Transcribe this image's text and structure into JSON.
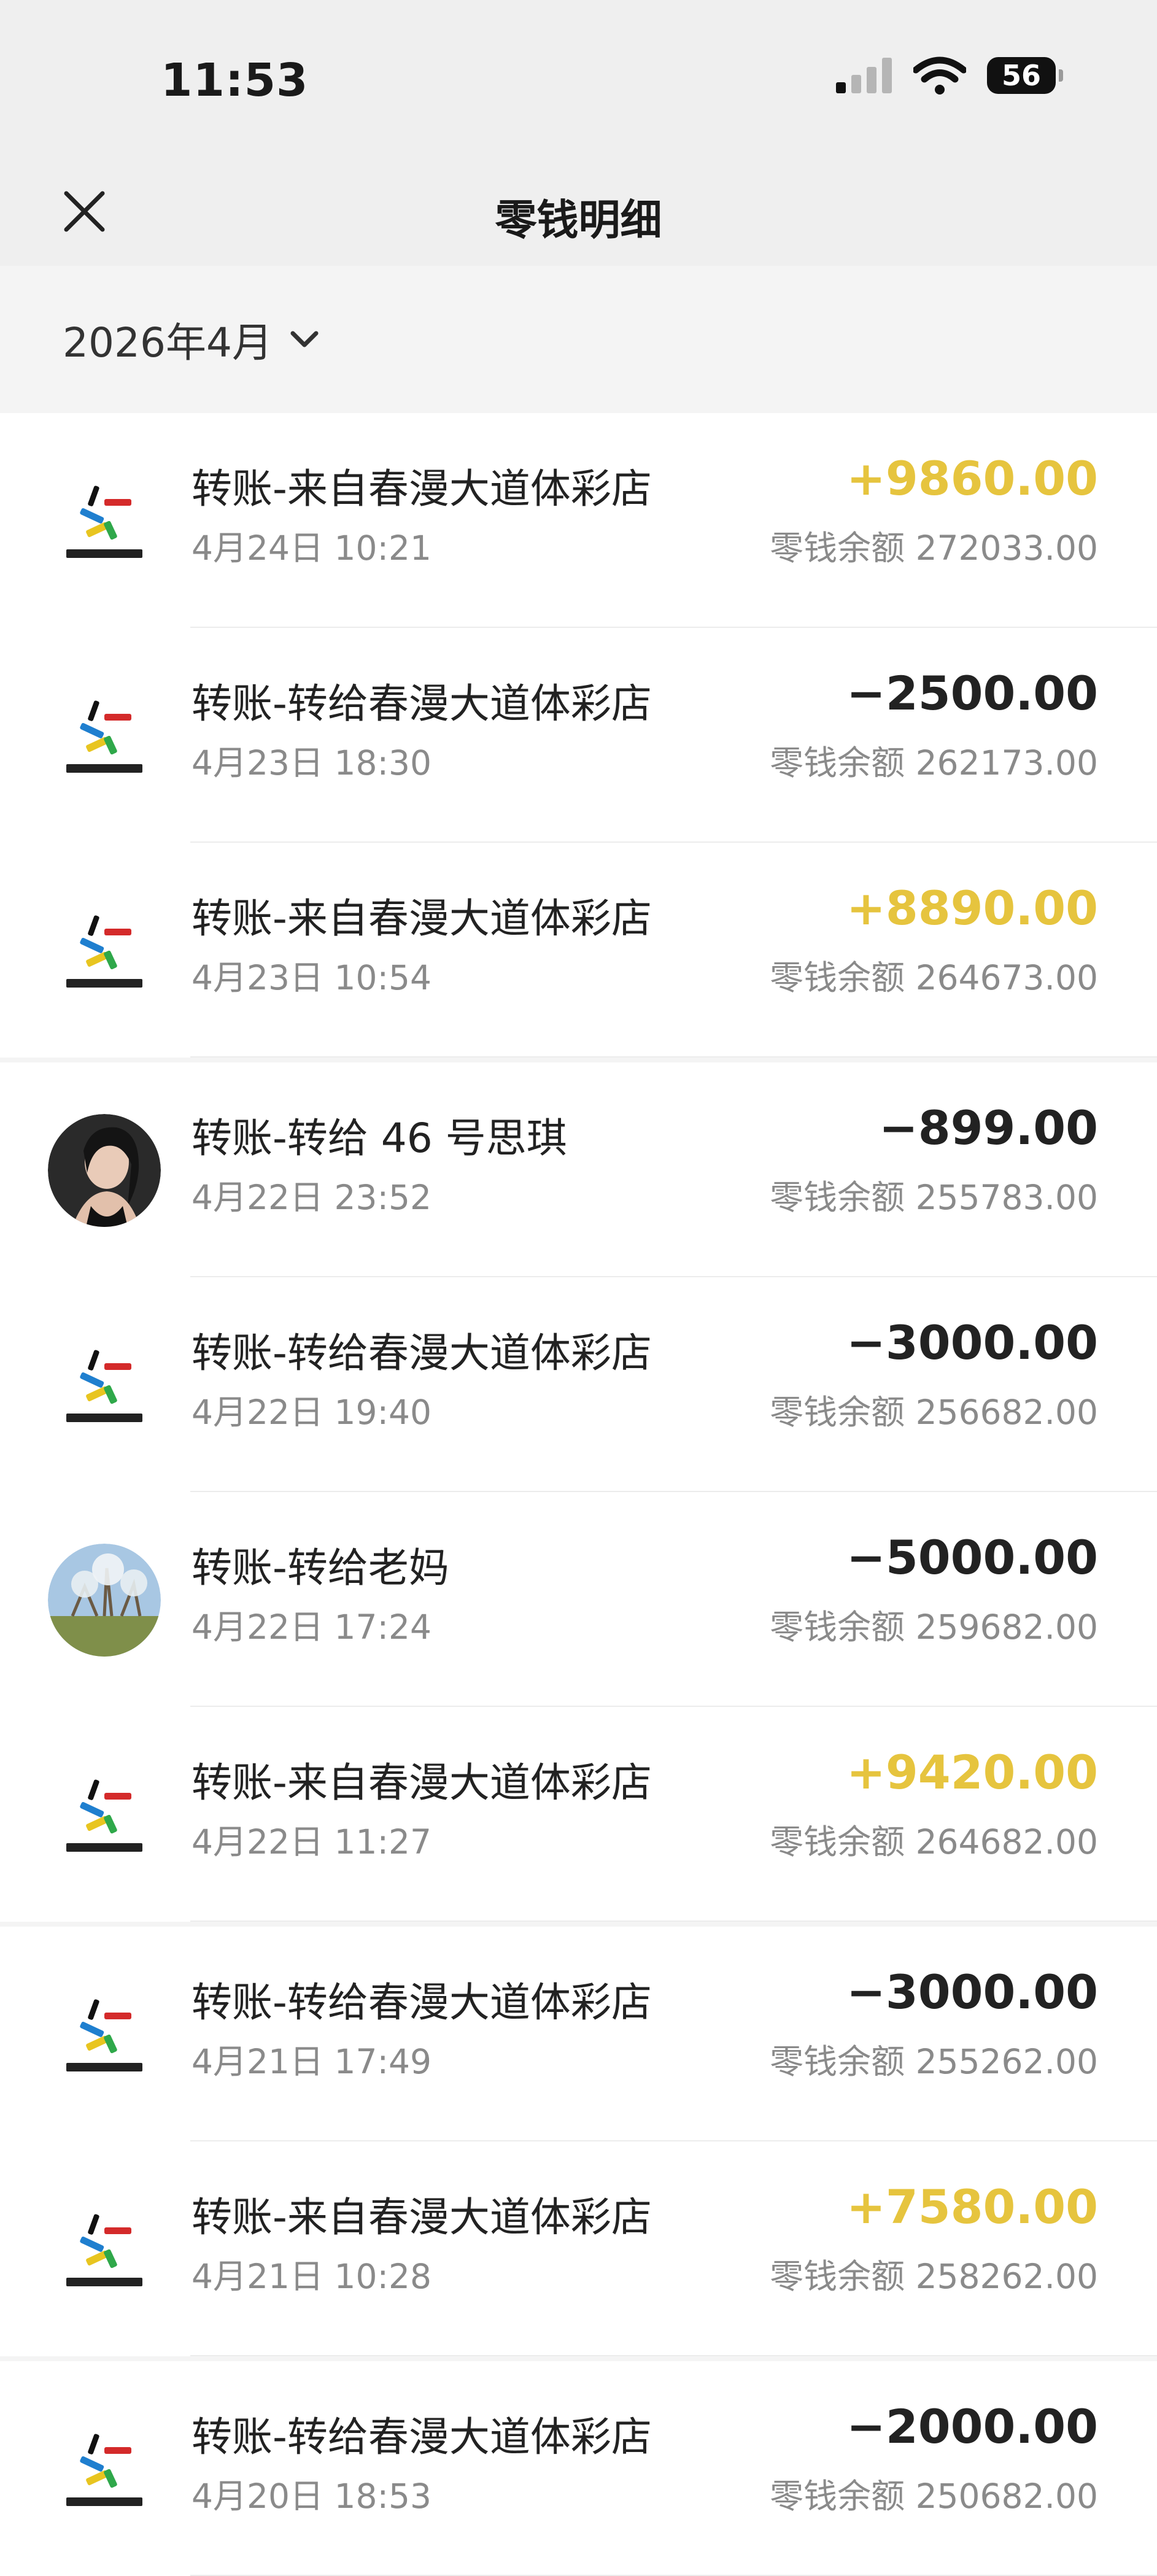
{
  "status": {
    "time": "11:53",
    "battery": "56"
  },
  "header": {
    "title": "零钱明细"
  },
  "filter": {
    "month": "2026年4月"
  },
  "balance_prefix": "零钱余额",
  "colors": {
    "income": "#e6c43e",
    "expense": "#222222",
    "background": "#f4f4f4"
  },
  "transactions": [
    {
      "title": "转账-来自春漫大道体彩店",
      "time": "4月24日 10:21",
      "amount": "+9860.00",
      "balance": "272033.00",
      "avatar": "lottery-logo"
    },
    {
      "title": "转账-转给春漫大道体彩店",
      "time": "4月23日 18:30",
      "amount": "−2500.00",
      "balance": "262173.00",
      "avatar": "lottery-logo"
    },
    {
      "title": "转账-来自春漫大道体彩店",
      "time": "4月23日 10:54",
      "amount": "+8890.00",
      "balance": "264673.00",
      "avatar": "lottery-logo"
    },
    {
      "title": "转账-转给 46 号思琪",
      "time": "4月22日 23:52",
      "amount": "−899.00",
      "balance": "255783.00",
      "avatar": "person-photo"
    },
    {
      "title": "转账-转给春漫大道体彩店",
      "time": "4月22日 19:40",
      "amount": "−3000.00",
      "balance": "256682.00",
      "avatar": "lottery-logo"
    },
    {
      "title": "转账-转给老妈",
      "time": "4月22日 17:24",
      "amount": "−5000.00",
      "balance": "259682.00",
      "avatar": "landscape-photo"
    },
    {
      "title": "转账-来自春漫大道体彩店",
      "time": "4月22日 11:27",
      "amount": "+9420.00",
      "balance": "264682.00",
      "avatar": "lottery-logo"
    },
    {
      "title": "转账-转给春漫大道体彩店",
      "time": "4月21日 17:49",
      "amount": "−3000.00",
      "balance": "255262.00",
      "avatar": "lottery-logo"
    },
    {
      "title": "转账-来自春漫大道体彩店",
      "time": "4月21日 10:28",
      "amount": "+7580.00",
      "balance": "258262.00",
      "avatar": "lottery-logo"
    },
    {
      "title": "转账-转给春漫大道体彩店",
      "time": "4月20日 18:53",
      "amount": "−2000.00",
      "balance": "250682.00",
      "avatar": "lottery-logo"
    }
  ]
}
